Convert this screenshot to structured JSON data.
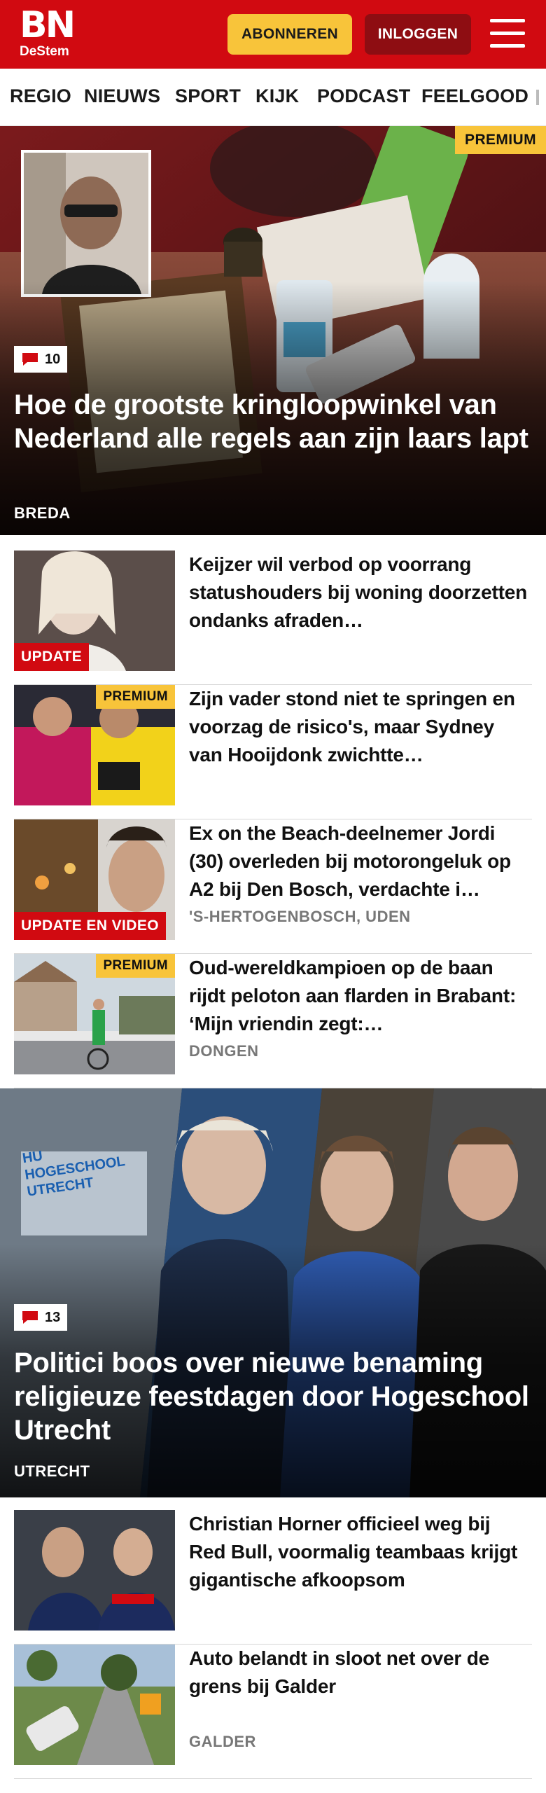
{
  "header": {
    "logo_main": "BN",
    "logo_sub": "DeStem",
    "subscribe_label": "ABONNEREN",
    "login_label": "INLOGGEN",
    "menu_icon": "hamburger-menu-icon",
    "colors": {
      "brand_red": "#d10a11",
      "subscribe_yellow": "#f8c43a",
      "login_dark_red": "#8e0d12"
    }
  },
  "nav": {
    "items": [
      "REGIO",
      "NIEUWS",
      "SPORT",
      "KIJK",
      "PODCAST",
      "FEELGOOD"
    ]
  },
  "hero1": {
    "premium_label": "PREMIUM",
    "comments": "10",
    "title": "Hoe de grootste kringloopwinkel van Nederland alle regels aan zijn laars lapt",
    "location": "BREDA"
  },
  "articles1": [
    {
      "title": "Keijzer wil verbod op voorrang statushouders bij woning doorzetten ondanks afraden…",
      "label": "UPDATE",
      "location": ""
    },
    {
      "title": "Zijn vader stond niet te springen en voorzag de risico's, maar Sydney van Hooijdonk zwichtte…",
      "premium_label": "PREMIUM",
      "location": ""
    },
    {
      "title": "Ex on the Beach-deelnemer Jordi (30) overleden bij motorongeluk op A2 bij Den Bosch, verdachte i…",
      "label": "UPDATE EN VIDEO",
      "location": "'S-HERTOGENBOSCH, UDEN"
    },
    {
      "title": "Oud-wereldkampioen op de baan rijdt peloton aan flarden in Brabant: ‘Mijn vriendin zegt:…",
      "premium_label": "PREMIUM",
      "location": "DONGEN"
    }
  ],
  "hero2": {
    "comments": "13",
    "title": "Politici boos over nieuwe benaming religieuze feestdagen door Hogeschool Utrecht",
    "location": "UTRECHT",
    "sign_text": "HU HOGESCHOOL UTRECHT"
  },
  "articles2": [
    {
      "title": "Christian Horner officieel weg bij Red Bull, voormalig teambaas krijgt gigantische afkoopsom",
      "location": ""
    },
    {
      "title": "Auto belandt in sloot net over de grens bij Galder",
      "location": "GALDER"
    }
  ]
}
